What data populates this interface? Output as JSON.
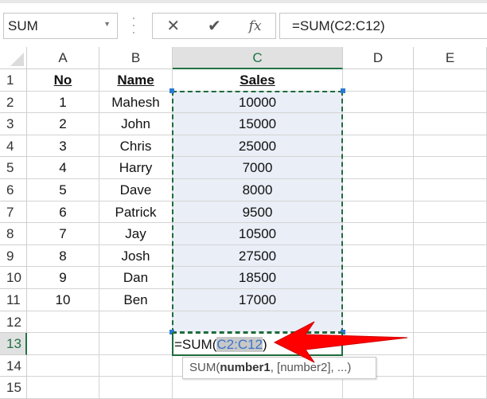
{
  "name_box": {
    "value": "SUM"
  },
  "formula_bar": {
    "value": "=SUM(C2:C12)",
    "cancel_icon": "x-icon",
    "enter_icon": "check-icon",
    "fx_label": "fx"
  },
  "columns": [
    "A",
    "B",
    "C",
    "D",
    "E"
  ],
  "selected_column": "C",
  "row_numbers": [
    "1",
    "2",
    "3",
    "4",
    "5",
    "6",
    "7",
    "8",
    "9",
    "10",
    "11",
    "12",
    "13",
    "14",
    "15"
  ],
  "selected_row": "13",
  "headers": {
    "A": "No",
    "B": "Name",
    "C": "Sales"
  },
  "rows": [
    {
      "no": "1",
      "name": "Mahesh",
      "sales": "10000"
    },
    {
      "no": "2",
      "name": "John",
      "sales": "15000"
    },
    {
      "no": "3",
      "name": "Chris",
      "sales": "25000"
    },
    {
      "no": "4",
      "name": "Harry",
      "sales": "7000"
    },
    {
      "no": "5",
      "name": "Dave",
      "sales": "8000"
    },
    {
      "no": "6",
      "name": "Patrick",
      "sales": "9500"
    },
    {
      "no": "7",
      "name": "Jay",
      "sales": "10500"
    },
    {
      "no": "8",
      "name": "Josh",
      "sales": "27500"
    },
    {
      "no": "9",
      "name": "Dan",
      "sales": "18500"
    },
    {
      "no": "10",
      "name": "Ben",
      "sales": "17000"
    }
  ],
  "editing_cell": {
    "prefix": "=SUM(",
    "ref": "C2:C12",
    "suffix": ")"
  },
  "tooltip": {
    "fn": "SUM(",
    "arg1": "number1",
    "rest": ", [number2], ...)"
  },
  "colors": {
    "accent": "#217346",
    "arrow": "#ff0000",
    "range": "#2b7ad6"
  }
}
